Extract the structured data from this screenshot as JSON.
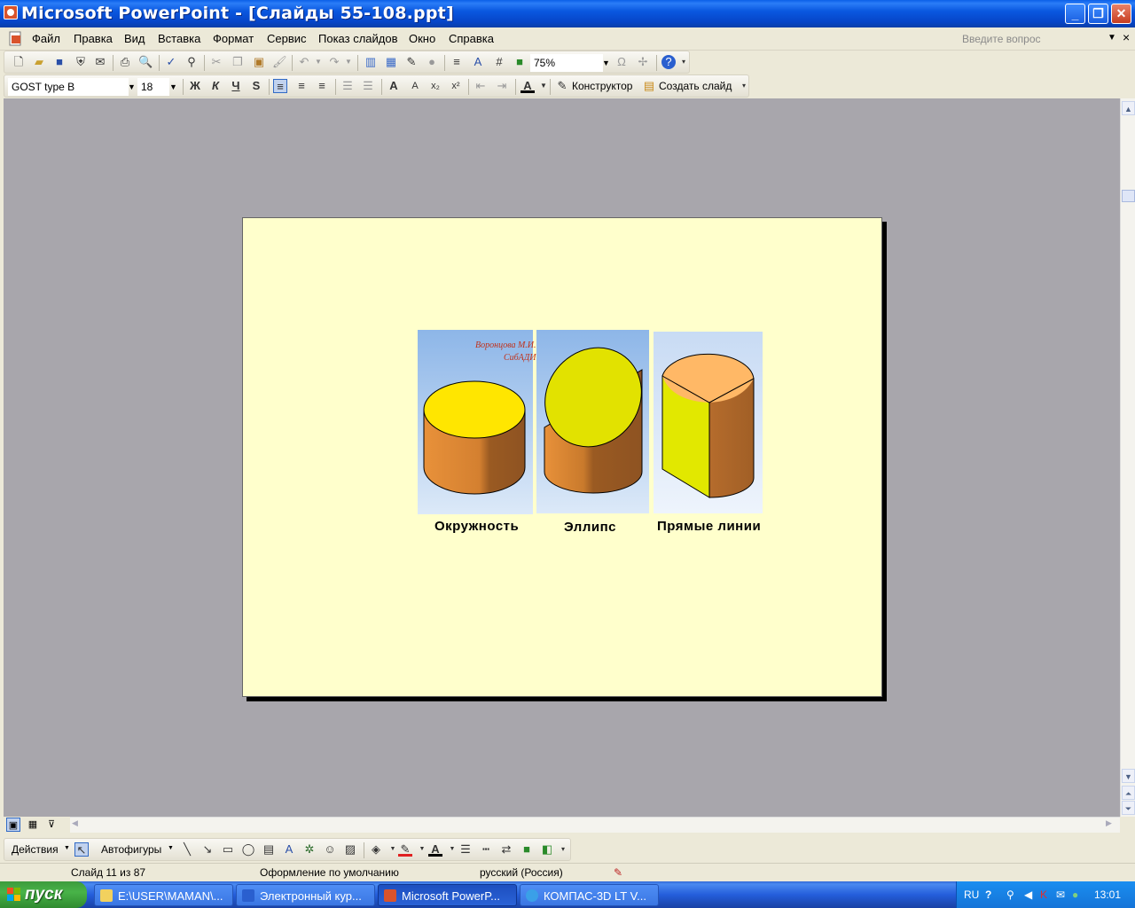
{
  "window": {
    "title": "Microsoft PowerPoint - [Слайды 55-108.ppt]",
    "minimize": "_",
    "maximize": "❐",
    "close": "✕"
  },
  "menu": {
    "items": [
      "Файл",
      "Правка",
      "Вид",
      "Вставка",
      "Формат",
      "Сервис",
      "Показ слайдов",
      "Окно",
      "Справка"
    ],
    "ask_placeholder": "Введите вопрос",
    "doc_close": "×"
  },
  "standard_toolbar": {
    "zoom": "75%"
  },
  "format_toolbar": {
    "font": "GOST type B",
    "size": "18",
    "bold": "Ж",
    "italic": "К",
    "underline": "Ч",
    "shadow": "S",
    "designer": "Конструктор",
    "new_slide": "Создать слайд"
  },
  "slide": {
    "author_line1": "Воронцова М.И.",
    "author_line2": "СибАДИ",
    "captions": [
      "Окружность",
      "Эллипс",
      "Прямые линии"
    ],
    "colors": {
      "background": "#ffffcc",
      "cylinder_side": "#e8913a",
      "circle_top": "#ffe600",
      "ellipse_top": "#e2e200",
      "flat_face": "#e2e800",
      "cut_top": "#ffb866"
    }
  },
  "draw_toolbar": {
    "actions": "Действия",
    "autoshapes": "Автофигуры"
  },
  "status": {
    "slide": "Слайд 11 из 87",
    "design": "Оформление по умолчанию",
    "language": "русский (Россия)"
  },
  "taskbar": {
    "start": "пуск",
    "tasks": [
      "E:\\USER\\MAMAN\\...",
      "Электронный кур...",
      "Microsoft PowerP...",
      "КОМПАС-3D LT V..."
    ],
    "lang": "RU",
    "time": "13:01"
  }
}
